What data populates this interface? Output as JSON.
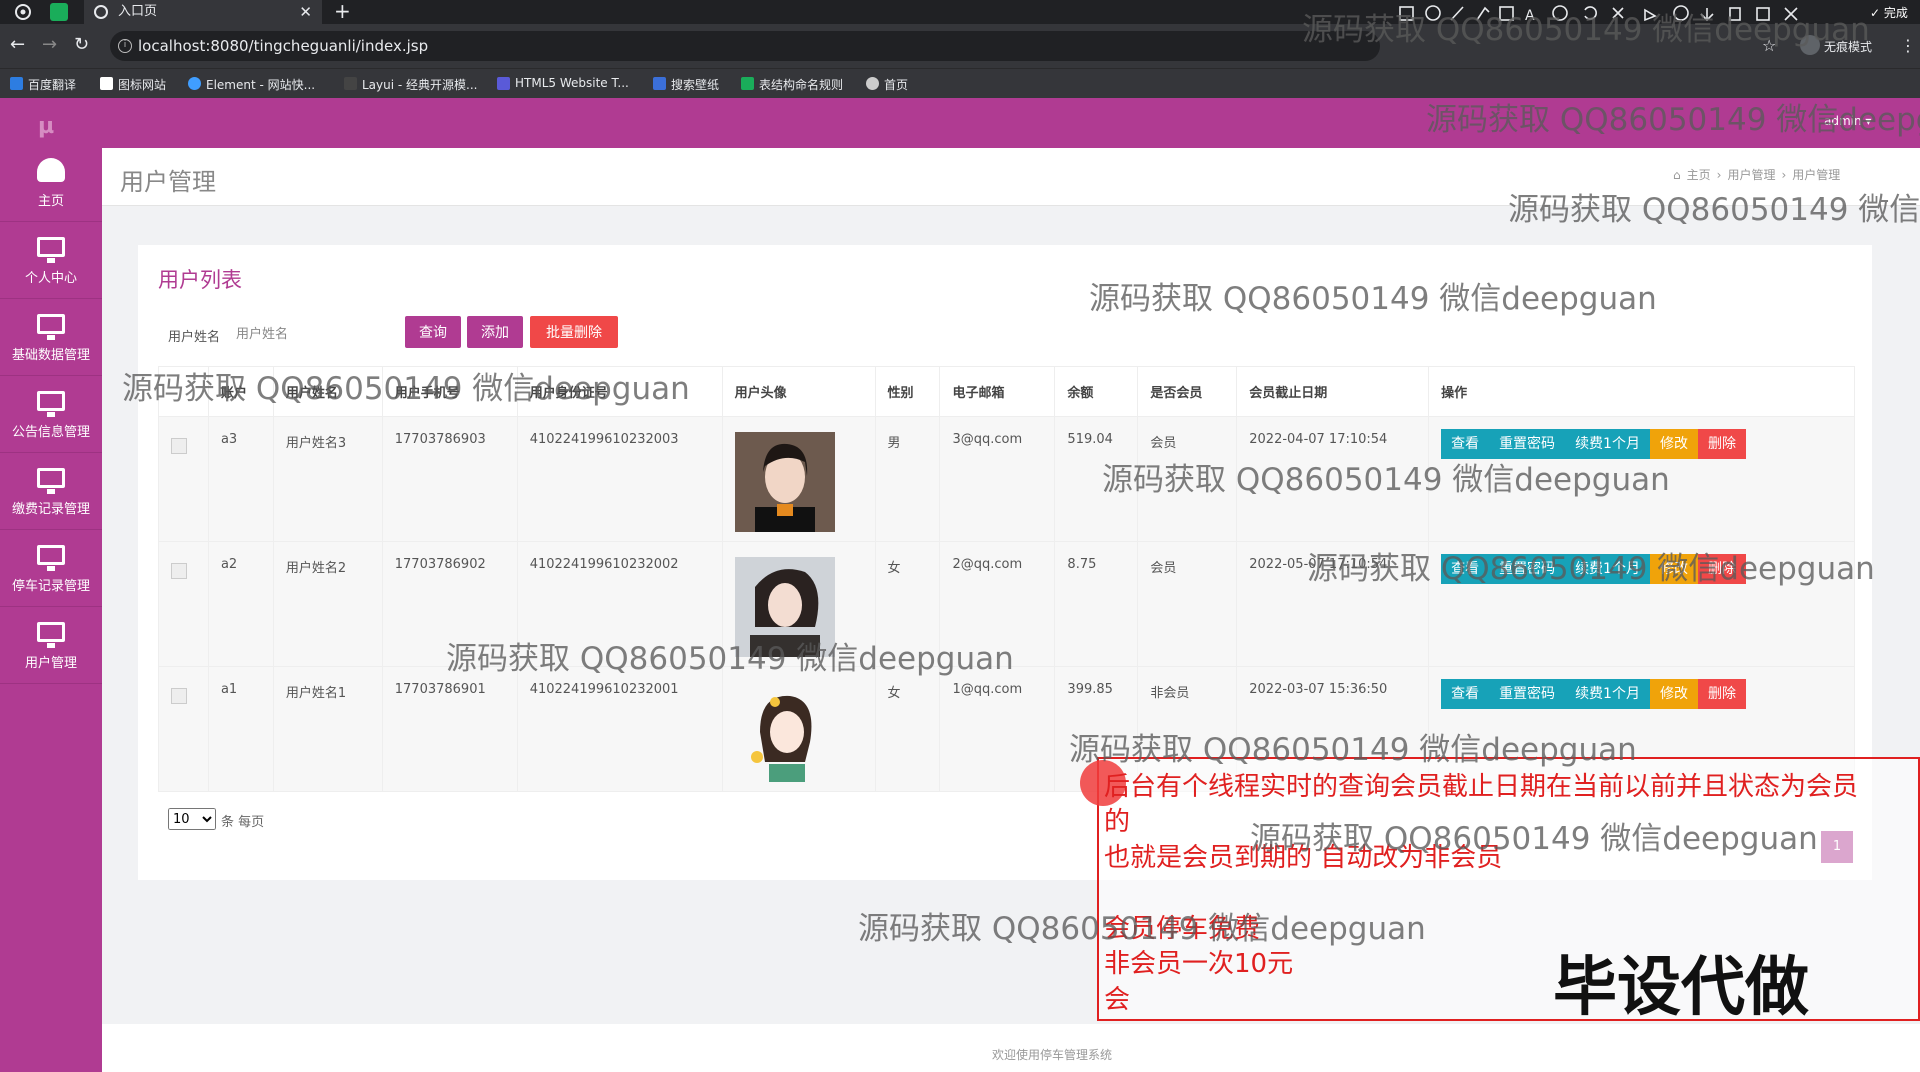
{
  "browser": {
    "tab_title": "入口页",
    "url": "localhost:8080/tingcheguanli/index.jsp",
    "incognito_label": "无痕模式",
    "bookmarks": [
      "百度翻译",
      "图标网站",
      "Element - 网站快...",
      "Layui - 经典开源模...",
      "HTML5 Website T...",
      "搜索壁纸",
      "表结构命名规则",
      "首页"
    ]
  },
  "screenshot_tool": {
    "font_size": "20",
    "done_label": "完成",
    "colors": [
      "#f44336",
      "#000000",
      "#5b5b5b",
      "#9e1b1b",
      "#c0392b",
      "#e67e22",
      "#27ae60",
      "#2980b9",
      "#8e44ad",
      "#1abc9c",
      "#ffffff",
      "#bdbdbd",
      "#f5a623",
      "#f1c40f",
      "#7ed321",
      "#4a90e2",
      "#bd10e0",
      "#50e3c2"
    ]
  },
  "sidebar": {
    "logo": "µ",
    "items": [
      {
        "label": "主页",
        "icon": "dashboard-icon"
      },
      {
        "label": "个人中心",
        "icon": "monitor-icon"
      },
      {
        "label": "基础数据管理",
        "icon": "monitor-icon"
      },
      {
        "label": "公告信息管理",
        "icon": "monitor-icon"
      },
      {
        "label": "缴费记录管理",
        "icon": "monitor-icon"
      },
      {
        "label": "停车记录管理",
        "icon": "monitor-icon"
      },
      {
        "label": "用户管理",
        "icon": "monitor-icon"
      }
    ]
  },
  "header": {
    "user": "admin",
    "page_title": "用户管理",
    "breadcrumb": [
      "主页",
      "用户管理",
      "用户管理"
    ]
  },
  "main": {
    "card_title": "用户列表",
    "search_label": "用户姓名",
    "search_placeholder": "用户姓名",
    "query_label": "查询",
    "add_label": "添加",
    "batch_delete_label": "批量删除",
    "columns": [
      "",
      "账户",
      "用户姓名",
      "用户手机号",
      "用户身份证号",
      "用户头像",
      "性别",
      "电子邮箱",
      "余额",
      "是否会员",
      "会员截止日期",
      "操作"
    ],
    "rows": [
      {
        "account": "a3",
        "name": "用户姓名3",
        "phone": "17703786903",
        "id_card": "410224199610232003",
        "gender": "男",
        "email": "3@qq.com",
        "balance": "519.04",
        "member": "会员",
        "expiry": "2022-04-07 17:10:54"
      },
      {
        "account": "a2",
        "name": "用户姓名2",
        "phone": "17703786902",
        "id_card": "410224199610232002",
        "gender": "女",
        "email": "2@qq.com",
        "balance": "8.75",
        "member": "会员",
        "expiry": "2022-05-07 17:10:54"
      },
      {
        "account": "a1",
        "name": "用户姓名1",
        "phone": "17703786901",
        "id_card": "410224199610232001",
        "gender": "女",
        "email": "1@qq.com",
        "balance": "399.85",
        "member": "非会员",
        "expiry": "2022-03-07 15:36:50"
      }
    ],
    "row_actions": [
      "查看",
      "重置密码",
      "续费1个月",
      "修改",
      "删除"
    ],
    "page_size": "10",
    "per_page_label": "条 每页",
    "current_page": "1"
  },
  "footer": "欢迎使用停车管理系统",
  "annotation": {
    "lines": [
      "后台有个线程实时的查询会员截止日期在当前以前并且状态为会员",
      "的",
      "也就是会员到期的  自动改为非会员",
      "",
      "会员停车免费",
      "非会员一次10元",
      "会"
    ],
    "stamp": "毕设代做"
  },
  "watermark": "源码获取 QQ86050149 微信deepguan"
}
